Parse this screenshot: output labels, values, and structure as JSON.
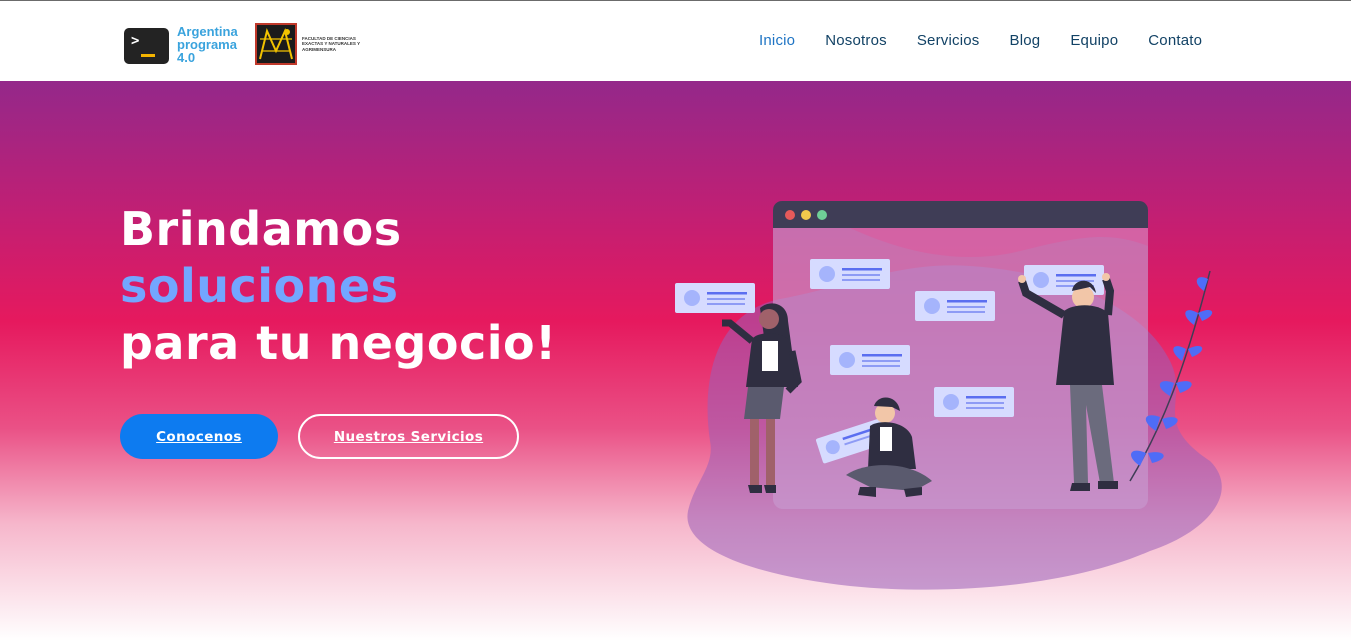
{
  "brand": {
    "name": "Argentina programa 4.0",
    "faculty": "Facultad de Ciencias Exactas y Naturales y Agrimensura",
    "terminal_prompt": ">"
  },
  "nav": {
    "items": [
      {
        "label": "Inicio",
        "active": true
      },
      {
        "label": "Nosotros",
        "active": false
      },
      {
        "label": "Servicios",
        "active": false
      },
      {
        "label": "Blog",
        "active": false
      },
      {
        "label": "Equipo",
        "active": false
      },
      {
        "label": "Contato",
        "active": false
      }
    ]
  },
  "hero": {
    "line1": "Brindamos",
    "line2": "soluciones",
    "line3": "para tu negocio!",
    "primary_button": "Conocenos",
    "secondary_button": "Nuestros Servicios"
  },
  "colors": {
    "accent_blue": "#0d7bf0",
    "highlight": "#73a6ff",
    "nav_text": "#124265",
    "gradient_top": "#94288a",
    "gradient_mid": "#e6195e"
  },
  "illustration": {
    "name": "team collaborating on a web page illustration"
  }
}
